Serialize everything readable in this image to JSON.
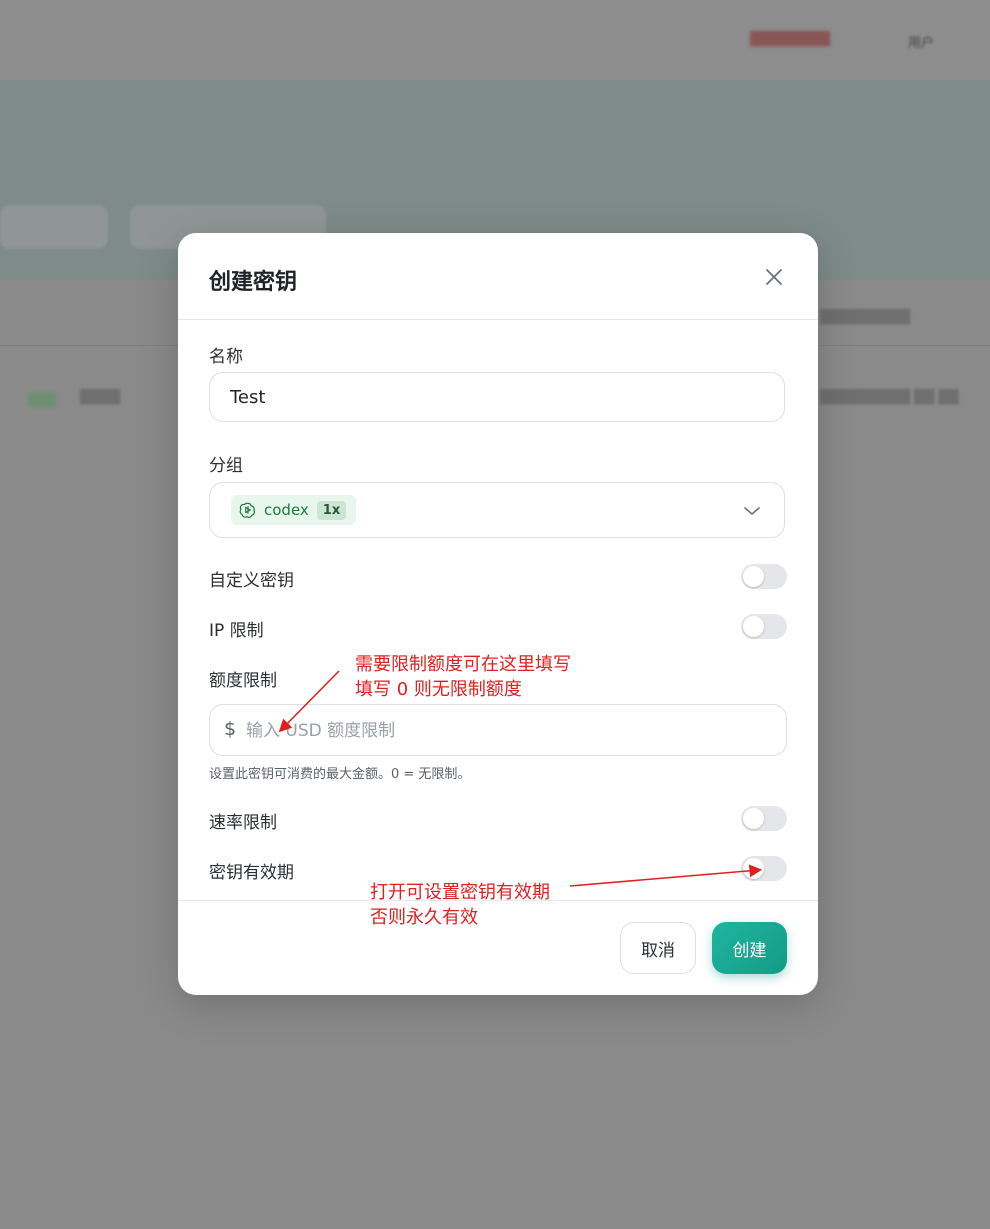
{
  "background": {
    "top_right_red": "████████",
    "top_right_user": "用户",
    "filter_1": "█",
    "filter_2": "████",
    "row_tag": "█",
    "row_text": "████",
    "right_text": "█████████",
    "right_date": "█████████ ██:██"
  },
  "modal": {
    "title": "创建密钥",
    "name_label": "名称",
    "name_value": "Test",
    "group_label": "分组",
    "group": {
      "name": "codex",
      "multiplier": "1x",
      "icon": "openai-logo-icon"
    },
    "custom_key_label": "自定义密钥",
    "custom_key_on": false,
    "ip_limit_label": "IP 限制",
    "ip_limit_on": false,
    "quota_label": "额度限制",
    "quota_currency": "$",
    "quota_placeholder": "输入 USD 额度限制",
    "quota_help": "设置此密钥可消费的最大金额。0 = 无限制。",
    "rate_limit_label": "速率限制",
    "rate_limit_on": false,
    "expiry_label": "密钥有效期",
    "expiry_on": false,
    "cancel_label": "取消",
    "create_label": "创建"
  },
  "annotations": {
    "quota_note_line1": "需要限制额度可在这里填写",
    "quota_note_line2": "填写 0 则无限制额度",
    "expiry_note_line1": "打开可设置密钥有效期",
    "expiry_note_line2": "否则永久有效",
    "color": "#e02020"
  },
  "colors": {
    "primary": "#139c86",
    "tag_bg": "#e9f6ee",
    "tag_text": "#1f7a3c"
  }
}
